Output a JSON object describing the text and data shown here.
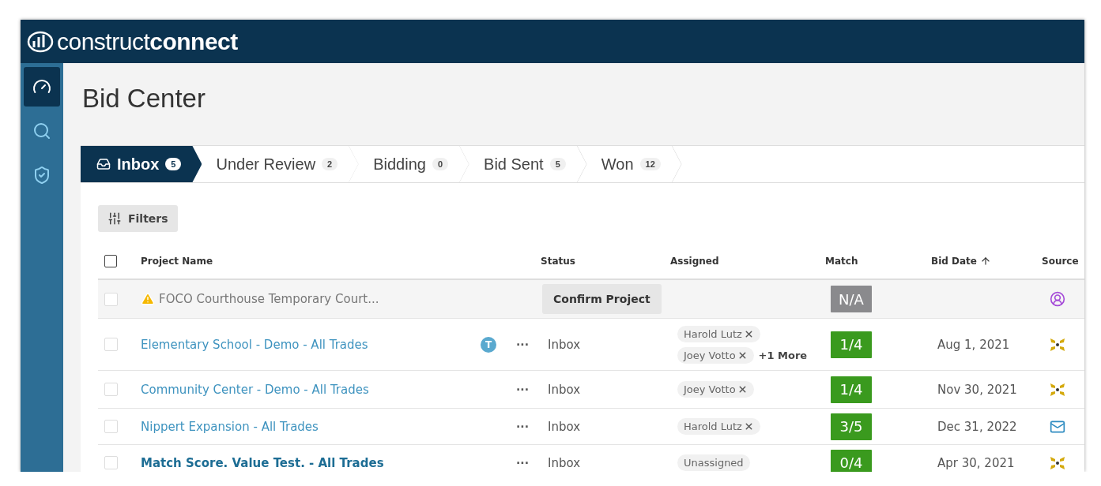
{
  "logo": {
    "light": "construct",
    "bold": "connect"
  },
  "sidebar": {
    "items": [
      {
        "kind": "dashboard",
        "selected": true
      },
      {
        "kind": "search",
        "selected": false
      },
      {
        "kind": "shield",
        "selected": false
      }
    ]
  },
  "page_title": "Bid Center",
  "tabs": [
    {
      "label": "Inbox",
      "count": "5",
      "selected": true
    },
    {
      "label": "Under Review",
      "count": "2",
      "selected": false
    },
    {
      "label": "Bidding",
      "count": "0",
      "selected": false
    },
    {
      "label": "Bid Sent",
      "count": "5",
      "selected": false
    },
    {
      "label": "Won",
      "count": "12",
      "selected": false
    }
  ],
  "filters_button": "Filters",
  "table": {
    "select_all": {
      "checked": false
    },
    "columns": [
      {
        "label": "Project Name",
        "sorted": false
      },
      {
        "label": "Status",
        "sorted": false
      },
      {
        "label": "Assigned",
        "sorted": false
      },
      {
        "label": "Match",
        "sorted": false
      },
      {
        "label": "Bid Date",
        "sorted": true
      },
      {
        "label": "Source",
        "sorted": false
      }
    ],
    "rows": [
      {
        "kind": "pending",
        "checked": false,
        "name": "FOCO Courthouse Temporary Court...",
        "bold": false,
        "status": "Confirm Project",
        "assigned": [],
        "match": "N/A",
        "bid_date": "",
        "source": {
          "kind": "person"
        }
      },
      {
        "kind": "project",
        "checked": false,
        "name": "Elementary School - Demo - All Trades",
        "bold": false,
        "badge": "T",
        "menu": "···",
        "status": "Inbox",
        "assigned": [
          {
            "label": "Harold Lutz",
            "removable": true
          },
          {
            "label": "Joey Votto",
            "removable": true
          }
        ],
        "more": "+1 More",
        "match": "1/4",
        "bid_date": "Aug 1, 2021",
        "source": {
          "kind": "network"
        }
      },
      {
        "kind": "project",
        "checked": false,
        "name": "Community Center - Demo - All Trades",
        "bold": false,
        "menu": "···",
        "status": "Inbox",
        "assigned": [
          {
            "label": "Joey Votto",
            "removable": true
          }
        ],
        "match": "1/4",
        "bid_date": "Nov 30, 2021",
        "source": {
          "kind": "network"
        }
      },
      {
        "kind": "project",
        "checked": false,
        "name": "Nippert Expansion - All Trades",
        "bold": false,
        "menu": "···",
        "status": "Inbox",
        "assigned": [
          {
            "label": "Harold Lutz",
            "removable": true
          }
        ],
        "match": "3/5",
        "bid_date": "Dec 31, 2022",
        "source": {
          "kind": "mail"
        }
      },
      {
        "kind": "project",
        "checked": false,
        "name": "Match Score. Value Test. - All Trades",
        "bold": true,
        "menu": "···",
        "status": "Inbox",
        "assigned": [
          {
            "label": "Unassigned",
            "removable": false
          }
        ],
        "match": "0/4",
        "bid_date": "Apr 30, 2021",
        "source": {
          "kind": "network"
        }
      }
    ]
  }
}
